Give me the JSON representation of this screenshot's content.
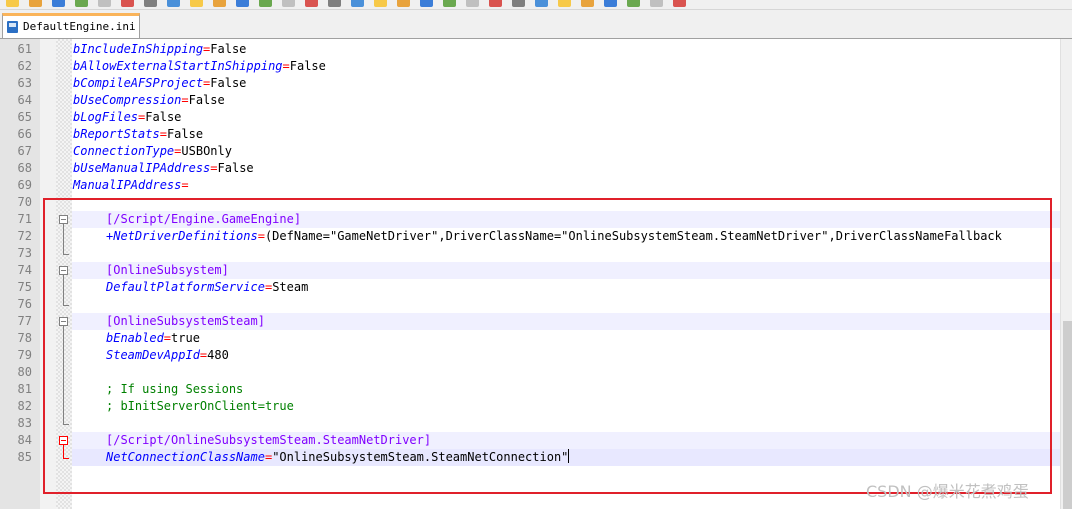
{
  "toolbar": {
    "buttons": [
      "new-file",
      "open-file",
      "save",
      "save-all",
      "close",
      "close-all",
      "print",
      "cut",
      "copy",
      "paste",
      "undo",
      "redo",
      "find",
      "replace",
      "zoom-in",
      "zoom-out",
      "sync-vertical",
      "sync-horizontal",
      "word-wrap",
      "show-all-chars",
      "indent-guide",
      "document-map",
      "function-list",
      "folder-workspace",
      "monitoring",
      "record-macro",
      "stop-record",
      "play-macro",
      "run-macro-multiple",
      "save-macro"
    ]
  },
  "tab": {
    "label": "DefaultEngine.ini",
    "close_glyph": "×"
  },
  "lines": [
    {
      "num": "61",
      "key": "bIncludeInShipping",
      "eq": "=",
      "value": "False"
    },
    {
      "num": "62",
      "key": "bAllowExternalStartInShipping",
      "eq": "=",
      "value": "False"
    },
    {
      "num": "63",
      "key": "bCompileAFSProject",
      "eq": "=",
      "value": "False"
    },
    {
      "num": "64",
      "key": "bUseCompression",
      "eq": "=",
      "value": "False"
    },
    {
      "num": "65",
      "key": "bLogFiles",
      "eq": "=",
      "value": "False"
    },
    {
      "num": "66",
      "key": "bReportStats",
      "eq": "=",
      "value": "False"
    },
    {
      "num": "67",
      "key": "ConnectionType",
      "eq": "=",
      "value": "USBOnly"
    },
    {
      "num": "68",
      "key": "bUseManualIPAddress",
      "eq": "=",
      "value": "False"
    },
    {
      "num": "69",
      "key": "ManualIPAddress",
      "eq": "=",
      "value": ""
    },
    {
      "num": "70"
    },
    {
      "num": "71",
      "section": "[/Script/Engine.GameEngine]"
    },
    {
      "num": "72",
      "key": "+NetDriverDefinitions",
      "eq": "=",
      "value": "(DefName=\"GameNetDriver\",DriverClassName=\"OnlineSubsystemSteam.SteamNetDriver\",DriverClassNameFallback"
    },
    {
      "num": "73"
    },
    {
      "num": "74",
      "section": "[OnlineSubsystem]"
    },
    {
      "num": "75",
      "key": "DefaultPlatformService",
      "eq": "=",
      "value": "Steam"
    },
    {
      "num": "76"
    },
    {
      "num": "77",
      "section": "[OnlineSubsystemSteam]"
    },
    {
      "num": "78",
      "key": "bEnabled",
      "eq": "=",
      "value": "true"
    },
    {
      "num": "79",
      "key": "SteamDevAppId",
      "eq": "=",
      "value": "480"
    },
    {
      "num": "80"
    },
    {
      "num": "81",
      "comment": "; If using Sessions"
    },
    {
      "num": "82",
      "comment": "; bInitServerOnClient=true"
    },
    {
      "num": "83"
    },
    {
      "num": "84",
      "section": "[/Script/OnlineSubsystemSteam.SteamNetDriver]"
    },
    {
      "num": "85",
      "key": "NetConnectionClassName",
      "eq": "=",
      "value": "\"OnlineSubsystemSteam.SteamNetConnection\""
    }
  ],
  "watermark": "CSDN @爆米花煮鸡蛋",
  "colors": {
    "key": "#0000ff",
    "operator": "#ff0000",
    "section": "#8000ff",
    "comment": "#008000",
    "highlight_box": "#e0202a",
    "active_tab_accent": "#fab45a"
  }
}
